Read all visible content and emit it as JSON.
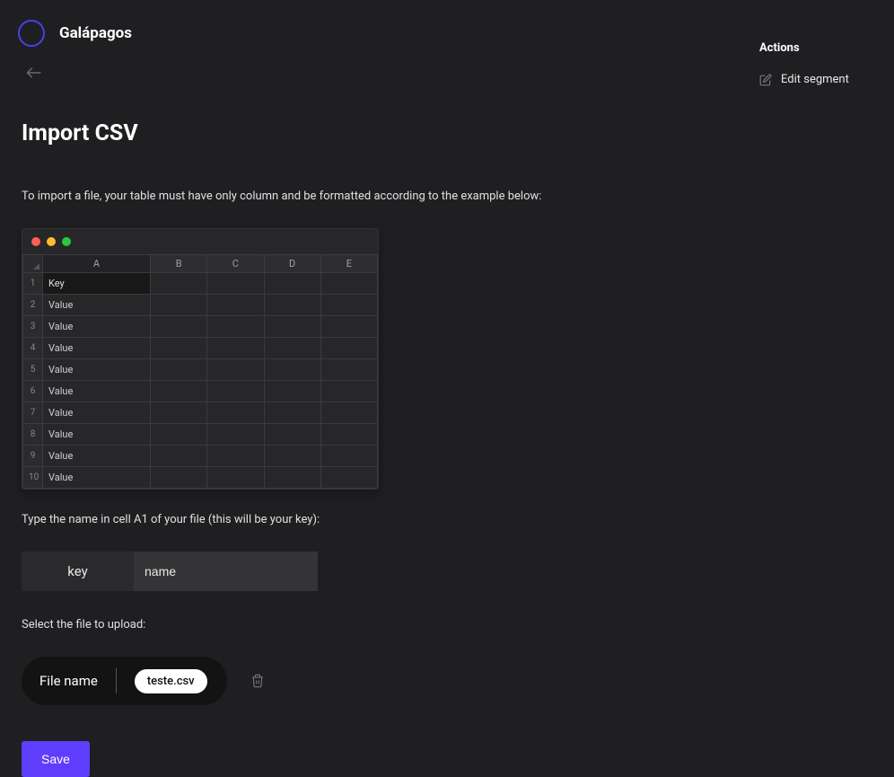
{
  "header": {
    "app_title": "Galápagos"
  },
  "actions": {
    "title": "Actions",
    "edit_segment": "Edit segment"
  },
  "page": {
    "title": "Import CSV",
    "instruction1": "To import a file, your table must have only column and be formatted according to the example below:",
    "key_instruction": "Type the name in cell A1 of your file (this will be your key):",
    "key_label": "key",
    "key_value": "name",
    "select_file_label": "Select the file to upload:",
    "file_name_label": "File name",
    "file_name_value": "teste.csv",
    "save_label": "Save"
  },
  "spreadsheet": {
    "columns": [
      "A",
      "B",
      "C",
      "D",
      "E"
    ],
    "rows": [
      {
        "num": "1",
        "a": "Key"
      },
      {
        "num": "2",
        "a": "Value"
      },
      {
        "num": "3",
        "a": "Value"
      },
      {
        "num": "4",
        "a": "Value"
      },
      {
        "num": "5",
        "a": "Value"
      },
      {
        "num": "6",
        "a": "Value"
      },
      {
        "num": "7",
        "a": "Value"
      },
      {
        "num": "8",
        "a": "Value"
      },
      {
        "num": "9",
        "a": "Value"
      },
      {
        "num": "10",
        "a": "Value"
      }
    ]
  }
}
